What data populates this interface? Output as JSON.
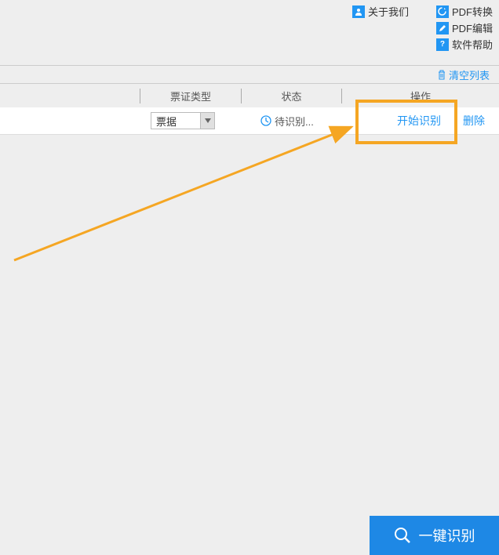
{
  "topLinks": {
    "about": "关于我们",
    "pdfConvert": "PDF转换",
    "pdfEdit": "PDF编辑",
    "softwareHelp": "软件帮助"
  },
  "clearList": "清空列表",
  "columns": {
    "type": "票证类型",
    "status": "状态",
    "action": "操作"
  },
  "row": {
    "typeValue": "票据",
    "statusText": "待识别...",
    "startRecognize": "开始识别",
    "delete": "删除"
  },
  "bottomButton": "一键识别"
}
